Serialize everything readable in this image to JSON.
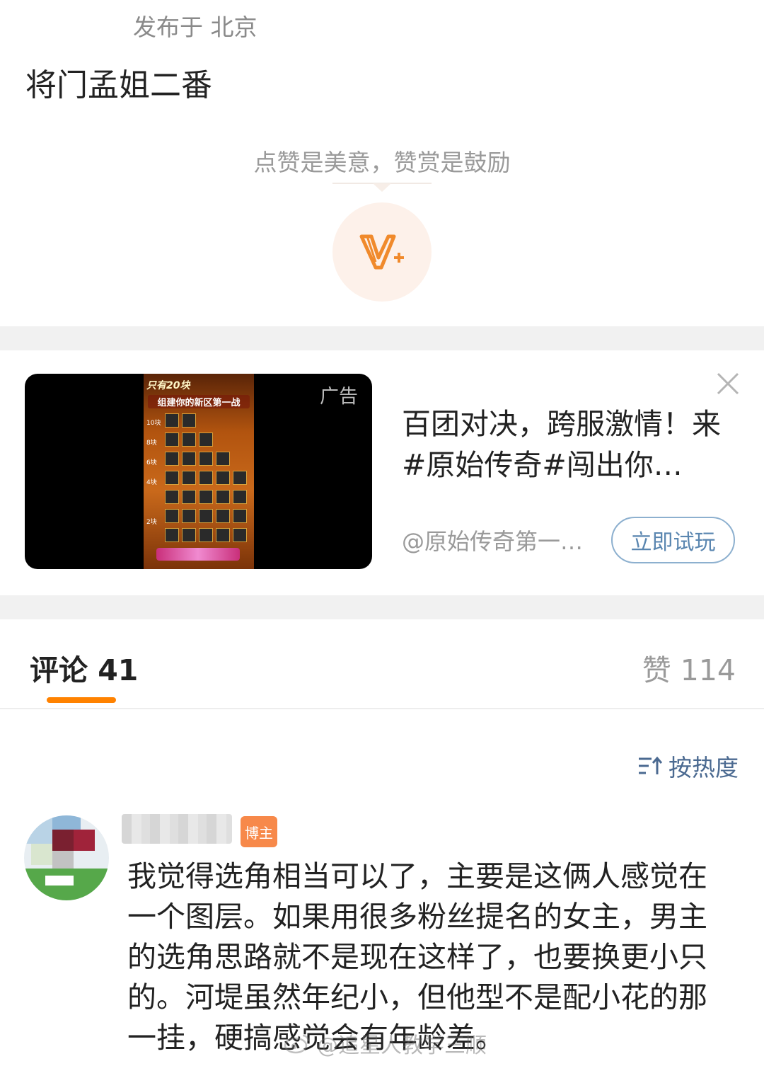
{
  "post": {
    "meta": "发布于 北京",
    "text": "将门孟姐二番"
  },
  "reward": {
    "hint": "点赞是美意，赞赏是鼓励",
    "icon": "v-plus-reward-icon"
  },
  "ad": {
    "tag": "广告",
    "title": "百团对决，跨服激情！来#原始传奇#闯出你…",
    "source": "@原始传奇第一…",
    "cta": "立即试玩",
    "poster_line1": "只有20块",
    "poster_line2": "组建你的新区第一战",
    "poster_tiers": [
      "10块",
      "8块",
      "6块",
      "4块",
      "2块"
    ]
  },
  "tabs": {
    "comments": "评论 41",
    "likes": "赞 114"
  },
  "sort": {
    "label": "按热度",
    "icon": "sort-icon"
  },
  "comment": {
    "badge": "博主",
    "text": "我觉得选角相当可以了，主要是这俩人感觉在一个图层。如果用很多粉丝提名的女主，男主的选角思路就不是现在这样了，也要换更小只的。河堤虽然年纪小，但他型不是配小花的那一挂，硬搞感觉会有年龄差。"
  },
  "watermark": "@追星人教学三顺",
  "colors": {
    "accent": "#ff8200",
    "link": "#4b6a91",
    "muted": "#9a9a9a"
  }
}
